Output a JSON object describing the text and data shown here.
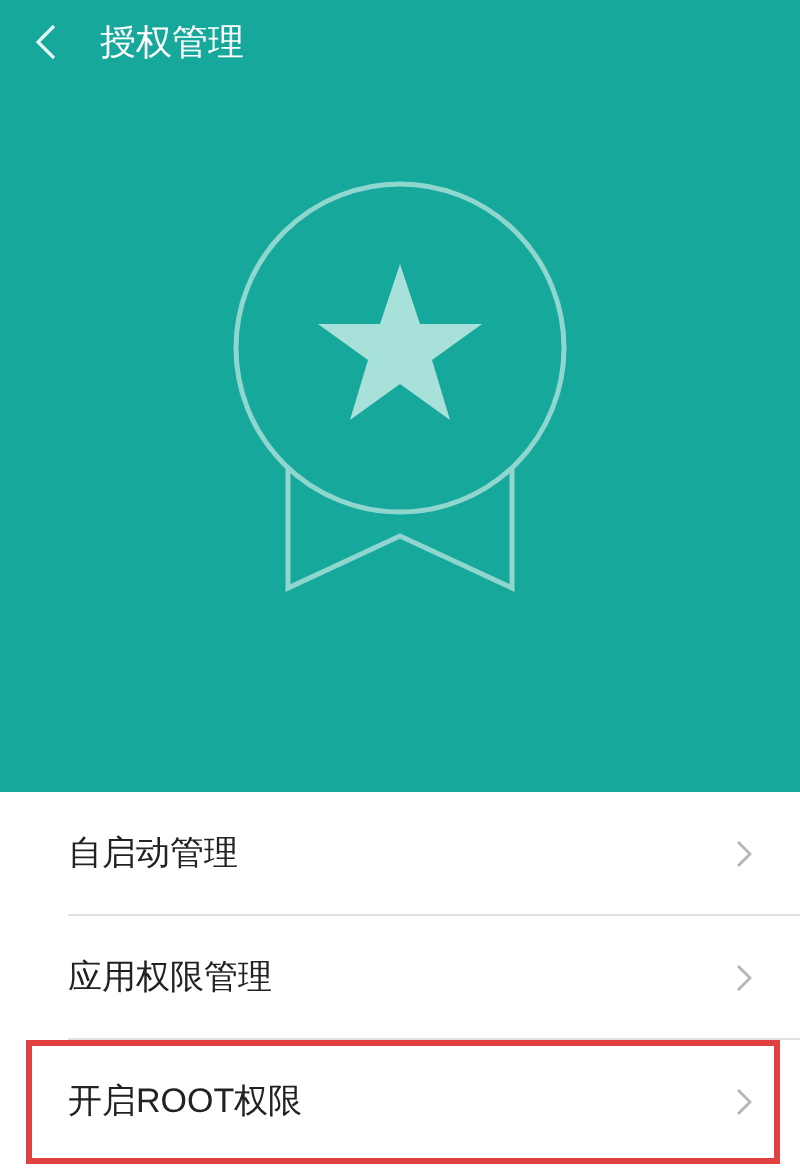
{
  "header": {
    "title": "授权管理"
  },
  "items": [
    {
      "label": "自启动管理",
      "highlighted": false
    },
    {
      "label": "应用权限管理",
      "highlighted": false
    },
    {
      "label": "开启ROOT权限",
      "highlighted": true
    }
  ]
}
